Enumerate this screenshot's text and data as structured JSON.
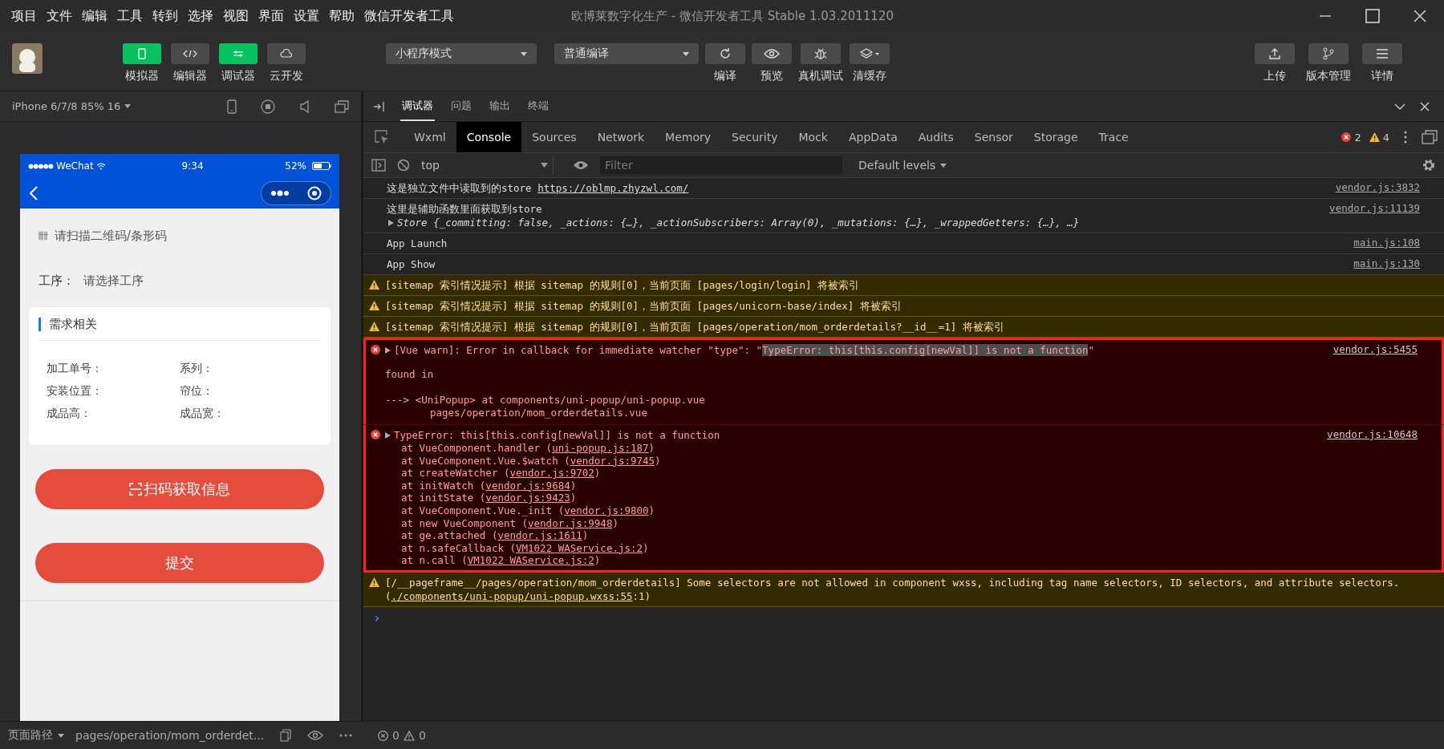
{
  "menu_bar": {
    "items": [
      "项目",
      "文件",
      "编辑",
      "工具",
      "转到",
      "选择",
      "视图",
      "界面",
      "设置",
      "帮助",
      "微信开发者工具"
    ],
    "title": "欧博莱数字化生产 - 微信开发者工具 Stable 1.03.2011120"
  },
  "toolbar": {
    "views": [
      {
        "label": "模拟器",
        "on": true,
        "kind": "phone"
      },
      {
        "label": "编辑器",
        "on": false,
        "kind": "code"
      },
      {
        "label": "调试器",
        "on": true,
        "kind": "debug"
      },
      {
        "label": "云开发",
        "on": false,
        "kind": "cloud"
      }
    ],
    "mode": "小程序模式",
    "compile_mode": "普通编译",
    "actions": [
      {
        "label": "编译",
        "kind": "refresh"
      },
      {
        "label": "预览",
        "kind": "eye"
      },
      {
        "label": "真机调试",
        "kind": "bug"
      },
      {
        "label": "清缓存",
        "kind": "layers"
      }
    ],
    "right_actions": [
      {
        "label": "上传",
        "kind": "upload"
      },
      {
        "label": "版本管理",
        "kind": "branch"
      },
      {
        "label": "详情",
        "kind": "menu"
      }
    ]
  },
  "simulator": {
    "device": "iPhone 6/7/8 85% 16",
    "carrier": "WeChat",
    "time": "9:34",
    "battery": "52%",
    "page": {
      "scan_placeholder": "请扫描二维码/条形码",
      "process_label": "工序：",
      "process_placeholder": "请选择工序",
      "section_title": "需求相关",
      "fields": [
        "加工单号：",
        "系列：",
        "安装位置：",
        "帘位：",
        "成品高：",
        "成品宽："
      ],
      "buttons": [
        {
          "label": "扫码获取信息",
          "kind": "scan"
        },
        {
          "label": "提交",
          "kind": "plain"
        }
      ]
    },
    "footer_label": "页面路径",
    "footer_path": "pages/operation/mom_orderdet..."
  },
  "devtools": {
    "tabs": [
      {
        "label": "调试器",
        "selected": true
      },
      {
        "label": "问题",
        "selected": false
      },
      {
        "label": "输出",
        "selected": false
      },
      {
        "label": "终端",
        "selected": false
      }
    ],
    "panels": [
      {
        "label": "Wxml",
        "selected": false
      },
      {
        "label": "Console",
        "selected": true
      },
      {
        "label": "Sources",
        "selected": false
      },
      {
        "label": "Network",
        "selected": false
      },
      {
        "label": "Memory",
        "selected": false
      },
      {
        "label": "Security",
        "selected": false
      },
      {
        "label": "Mock",
        "selected": false
      },
      {
        "label": "AppData",
        "selected": false
      },
      {
        "label": "Audits",
        "selected": false
      },
      {
        "label": "Sensor",
        "selected": false
      },
      {
        "label": "Storage",
        "selected": false
      },
      {
        "label": "Trace",
        "selected": false
      }
    ],
    "error_count": "2",
    "warning_count": "4",
    "context": "top",
    "filter_placeholder": "Filter",
    "levels": "Default levels",
    "entries": [
      {
        "kind": "log",
        "annotated": false,
        "text": "这是独立文件中读取到的store ",
        "link": "https://oblmp.zhyzwl.com/",
        "source": "vendor.js:3832"
      },
      {
        "kind": "log",
        "annotated": false,
        "text": "这里是辅助函数里面获取到store",
        "object": "Store {_committing: false, _actions: {…}, _actionSubscribers: Array(0), _mutations: {…}, _wrappedGetters: {…}, …}",
        "source": "vendor.js:11139"
      },
      {
        "kind": "log",
        "annotated": false,
        "text": "App Launch",
        "source": "main.js:108"
      },
      {
        "kind": "log",
        "annotated": false,
        "text": "App Show",
        "source": "main.js:130"
      },
      {
        "kind": "warn",
        "annotated": false,
        "text": "[sitemap 索引情况提示] 根据 sitemap 的规则[0]，当前页面 [pages/login/login] 将被索引"
      },
      {
        "kind": "warn",
        "annotated": false,
        "text": "[sitemap 索引情况提示] 根据 sitemap 的规则[0]，当前页面 [pages/unicorn-base/index] 将被索引"
      },
      {
        "kind": "warn",
        "annotated": false,
        "text": "[sitemap 索引情况提示] 根据 sitemap 的规则[0]，当前页面 [pages/operation/mom_orderdetails?__id__=1] 将被索引"
      },
      {
        "kind": "error",
        "annotated": true,
        "expandable": true,
        "text": "[Vue warn]: Error in callback for immediate watcher \"type\": \"",
        "highlight": "TypeError: this[this.config[newVal]] is not a function",
        "text_after": "\"",
        "source": "vendor.js:5455",
        "details": [
          "found in",
          "---> <UniPopup> at components/uni-popup/uni-popup.vue",
          "pages/operation/mom_orderdetails.vue"
        ]
      },
      {
        "kind": "error",
        "annotated": true,
        "expandable": true,
        "text": "TypeError: this[this.config[newVal]] is not a function",
        "source": "vendor.js:10648",
        "stack": [
          {
            "text": "at VueComponent.handler (",
            "link": "uni-popup.js:187",
            "text_after": ")"
          },
          {
            "text": "at VueComponent.Vue.$watch (",
            "link": "vendor.js:9745",
            "text_after": ")"
          },
          {
            "text": "at createWatcher (",
            "link": "vendor.js:9702",
            "text_after": ")"
          },
          {
            "text": "at initWatch (",
            "link": "vendor.js:9684",
            "text_after": ")"
          },
          {
            "text": "at initState (",
            "link": "vendor.js:9423",
            "text_after": ")"
          },
          {
            "text": "at VueComponent.Vue._init (",
            "link": "vendor.js:9800",
            "text_after": ")"
          },
          {
            "text": "at new VueComponent (",
            "link": "vendor.js:9948",
            "text_after": ")"
          },
          {
            "text": "at ge.attached (",
            "link": "vendor.js:1611",
            "text_after": ")"
          },
          {
            "text": "at n.safeCallback (",
            "link": "VM1022 WAService.js:2",
            "text_after": ")"
          },
          {
            "text": "at n.call (",
            "link": "VM1022 WAService.js:2",
            "text_after": ")"
          }
        ]
      },
      {
        "kind": "warn",
        "annotated": false,
        "text": "[/__pageframe__/pages/operation/mom_orderdetails] Some selectors are not allowed in component wxss, including tag name selectors, ID selectors, and attribute selectors.(",
        "link": "./components/uni-popup/uni-popup.wxss:55",
        "text_after": ":1)"
      }
    ],
    "prompt": "›"
  },
  "status_bar": {
    "errors": "0",
    "warnings": "0"
  }
}
